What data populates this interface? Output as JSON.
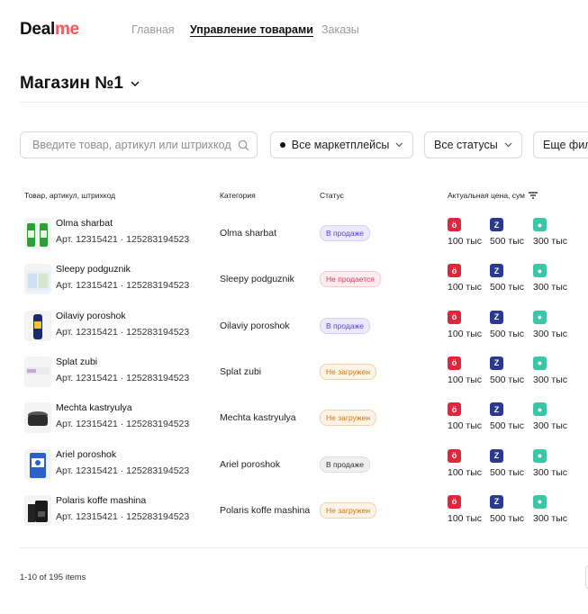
{
  "header": {
    "logo_part1": "Deal",
    "logo_part2": "me",
    "nav": [
      "Главная",
      "Управление товарами",
      "Заказы"
    ]
  },
  "store": {
    "name": "Магазин №1"
  },
  "filters": {
    "search_placeholder": "Введите товар, артикул или штрихкод",
    "marketplaces": "Все маркетплейсы",
    "statuses": "Все статусы",
    "more": "Еще фильтры"
  },
  "table": {
    "columns": [
      "Товар, артикул, штрихкод",
      "Категория",
      "Статус",
      "Актуальная цена, сум"
    ],
    "rows": [
      {
        "name": "Olma sharbat",
        "article": "Арт. 12315421  · 125283194523",
        "category": "Olma sharbat",
        "status": "В продаже",
        "status_type": "purple",
        "prices": [
          "100 тыс",
          "500 тыс",
          "300 тыс"
        ]
      },
      {
        "name": "Sleepy podguznik",
        "article": "Арт. 12315421  · 125283194523",
        "category": "Sleepy podguznik",
        "status": "Не продается",
        "status_type": "pink",
        "prices": [
          "100 тыс",
          "500 тыс",
          "300 тыс"
        ]
      },
      {
        "name": "Oilaviy poroshok",
        "article": "Арт. 12315421  · 125283194523",
        "category": "Oilaviy poroshok",
        "status": "В продаже",
        "status_type": "purple",
        "prices": [
          "100 тыс",
          "500 тыс",
          "300 тыс"
        ]
      },
      {
        "name": "Splat zubi",
        "article": "Арт. 12315421  · 125283194523",
        "category": "Splat zubi",
        "status": "Не загружен",
        "status_type": "orange",
        "prices": [
          "100 тыс",
          "500 тыс",
          "300 тыс"
        ]
      },
      {
        "name": "Mechta kastryulya",
        "article": "Арт. 12315421  · 125283194523",
        "category": "Mechta kastryulya",
        "status": "Не загружен",
        "status_type": "orange",
        "prices": [
          "100 тыс",
          "500 тыс",
          "300 тыс"
        ]
      },
      {
        "name": "Ariel poroshok",
        "article": "Арт. 12315421  · 125283194523",
        "category": "Ariel poroshok",
        "status": "В продаже",
        "status_type": "gray",
        "prices": [
          "100 тыс",
          "500 тыс",
          "300 тыс"
        ]
      },
      {
        "name": "Polaris koffe mashina",
        "article": "Арт. 12315421  · 125283194523",
        "category": "Polaris koffe mashina",
        "status": "Не загружен",
        "status_type": "orange",
        "prices": [
          "100 тыс",
          "500 тыс",
          "300 тыс"
        ]
      }
    ]
  },
  "marketplace_icons": [
    "uzum-market-icon",
    "zoodmall-icon",
    "olx-icon"
  ],
  "status_colors": {
    "purple": {
      "bg": "#ece9fb",
      "border": "#d6cff7",
      "fg": "#5b3fd6"
    },
    "pink": {
      "bg": "#fdecef",
      "border": "#f6c9d3",
      "fg": "#d43a5a"
    },
    "orange": {
      "bg": "#fdf3e6",
      "border": "#f3d3a6",
      "fg": "#c97a12"
    },
    "gray": {
      "bg": "#f0f0f0",
      "border": "#dedede",
      "fg": "#333333"
    }
  },
  "footer": {
    "items_text": "1-10 of 195 items"
  }
}
